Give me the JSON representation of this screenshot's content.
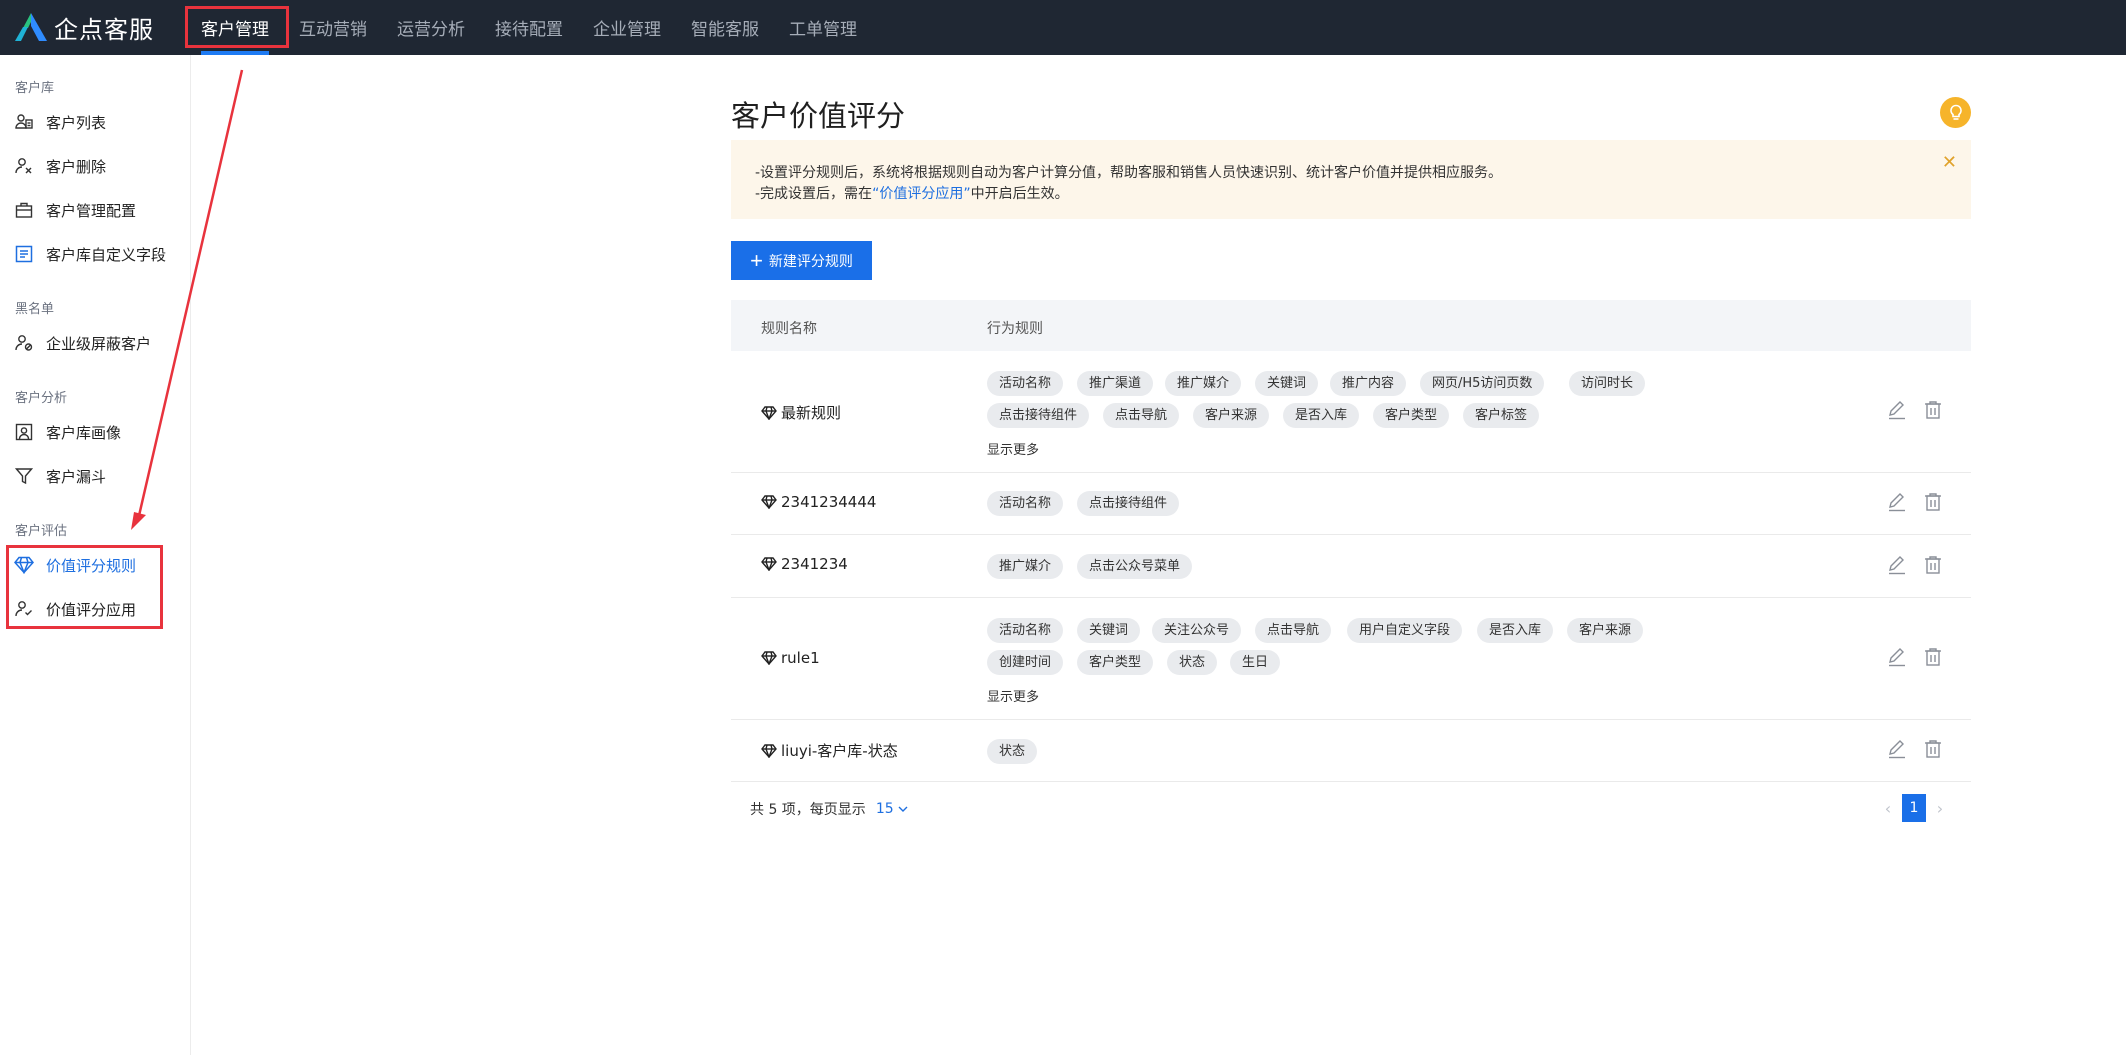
{
  "app": {
    "name": "企点客服",
    "colors": {
      "nav_bg": "#1f2733",
      "primary": "#1a6fe8",
      "annotation": "#e8333d",
      "notice_bg": "#fdf6ea",
      "bulb": "#f6b42a"
    }
  },
  "nav": {
    "items": [
      {
        "label": "客户管理",
        "active": true
      },
      {
        "label": "互动营销"
      },
      {
        "label": "运营分析"
      },
      {
        "label": "接待配置"
      },
      {
        "label": "企业管理"
      },
      {
        "label": "智能客服"
      },
      {
        "label": "工单管理"
      }
    ]
  },
  "sidebar": {
    "groups": [
      {
        "title": "客户库",
        "items": [
          {
            "label": "客户列表",
            "icon": "customer-list-icon"
          },
          {
            "label": "客户删除",
            "icon": "user-remove-icon"
          },
          {
            "label": "客户管理配置",
            "icon": "briefcase-icon"
          },
          {
            "label": "客户库自定义字段",
            "icon": "custom-field-icon"
          }
        ]
      },
      {
        "title": "黑名单",
        "items": [
          {
            "label": "企业级屏蔽客户",
            "icon": "user-block-icon"
          }
        ]
      },
      {
        "title": "客户分析",
        "items": [
          {
            "label": "客户库画像",
            "icon": "portrait-icon"
          },
          {
            "label": "客户漏斗",
            "icon": "funnel-icon"
          }
        ]
      },
      {
        "title": "客户评估",
        "items": [
          {
            "label": "价值评分规则",
            "icon": "diamond-icon",
            "active": true
          },
          {
            "label": "价值评分应用",
            "icon": "user-check-icon"
          }
        ]
      }
    ]
  },
  "page": {
    "title": "客户价值评分",
    "notice": {
      "line1": "-设置评分规则后，系统将根据规则自动为客户计算分值，帮助客服和销售人员快速识别、统计客户价值并提供相应服务。",
      "line2_prefix": "-完成设置后，需在",
      "line2_link": "“价值评分应用”",
      "line2_suffix": "中开启后生效。"
    },
    "new_button": "新建评分规则"
  },
  "table": {
    "headers": {
      "name": "规则名称",
      "rule": "行为规则"
    },
    "rows": [
      {
        "name": "最新规则",
        "tags": [
          "活动名称",
          "推广渠道",
          "推广媒介",
          "关键词",
          "推广内容",
          "网页/H5访问页数",
          "访问时长",
          "点击接待组件",
          "点击导航",
          "客户来源",
          "是否入库",
          "客户类型",
          "客户标签"
        ],
        "more": "显示更多"
      },
      {
        "name": "2341234444",
        "tags": [
          "活动名称",
          "点击接待组件"
        ]
      },
      {
        "name": "2341234",
        "tags": [
          "推广媒介",
          "点击公众号菜单"
        ]
      },
      {
        "name": "rule1",
        "tags": [
          "活动名称",
          "关键词",
          "关注公众号",
          "点击导航",
          "用户自定义字段",
          "是否入库",
          "客户来源",
          "创建时间",
          "客户类型",
          "状态",
          "生日"
        ],
        "more": "显示更多"
      },
      {
        "name": "liuyi-客户库-状态",
        "tags": [
          "状态"
        ]
      }
    ]
  },
  "footer": {
    "total_prefix": "共 5 项，每页显示",
    "page_size": "15",
    "current_page": "1"
  }
}
